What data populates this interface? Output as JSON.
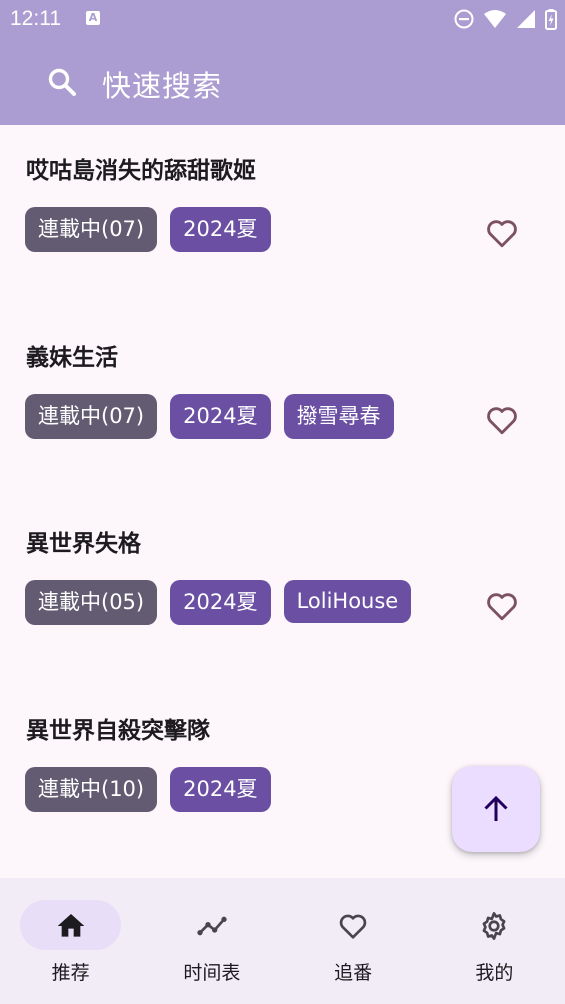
{
  "status_bar": {
    "time": "12:11",
    "notification_badge": "A"
  },
  "search": {
    "placeholder": "快速搜索"
  },
  "colors": {
    "app_bar": "#ab9dd1",
    "status_tag": "#625b71",
    "accent_tag": "#6a4fa3",
    "fab": "#eaddff",
    "nav_bg": "#f2ecf7"
  },
  "anime_list": [
    {
      "title": "哎咕島消失的舔甜歌姬",
      "tags": [
        "連載中(07)",
        "2024夏"
      ],
      "favorited": false
    },
    {
      "title": "義妹生活",
      "tags": [
        "連載中(07)",
        "2024夏",
        "撥雪尋春"
      ],
      "favorited": false
    },
    {
      "title": "異世界失格",
      "tags": [
        "連載中(05)",
        "2024夏",
        "LoliHouse"
      ],
      "favorited": false
    },
    {
      "title": "異世界自殺突擊隊",
      "tags": [
        "連載中(10)",
        "2024夏"
      ],
      "favorited": false
    }
  ],
  "fab": {
    "icon": "arrow-up-icon"
  },
  "bottom_nav": [
    {
      "label": "推荐",
      "icon": "home-icon",
      "active": true
    },
    {
      "label": "时间表",
      "icon": "trend-line-icon",
      "active": false
    },
    {
      "label": "追番",
      "icon": "heart-icon",
      "active": false
    },
    {
      "label": "我的",
      "icon": "gear-icon",
      "active": false
    }
  ]
}
